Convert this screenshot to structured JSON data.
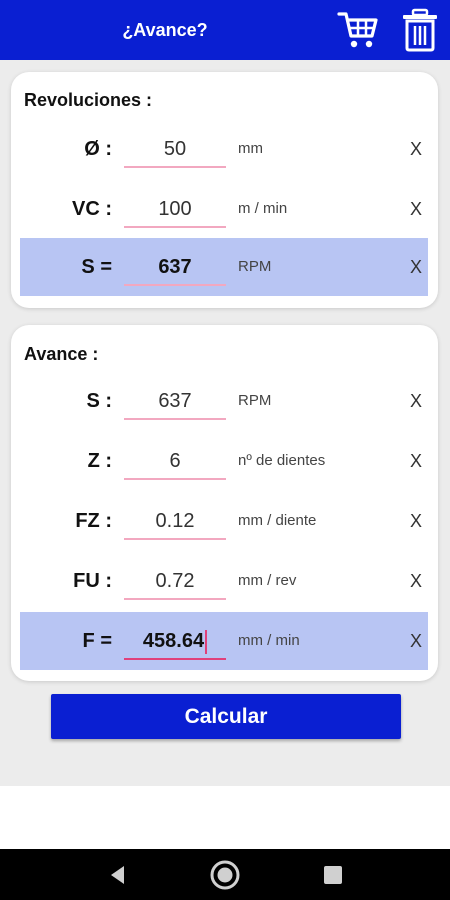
{
  "app": {
    "title": "¿Avance?"
  },
  "toolbar": {
    "cart_icon": "cart-icon",
    "trash_icon": "trash-icon"
  },
  "revoluciones": {
    "title": "Revoluciones :",
    "rows": [
      {
        "label": "Ø :",
        "value": "50",
        "unit": "mm",
        "clear": "X"
      },
      {
        "label": "VC :",
        "value": "100",
        "unit": "m / min",
        "clear": "X"
      },
      {
        "label": "S =",
        "value": "637",
        "unit": "RPM",
        "clear": "X"
      }
    ]
  },
  "avance": {
    "title": "Avance :",
    "rows": [
      {
        "label": "S :",
        "value": "637",
        "unit": "RPM",
        "clear": "X"
      },
      {
        "label": "Z :",
        "value": "6",
        "unit": "nº de dientes",
        "clear": "X"
      },
      {
        "label": "FZ :",
        "value": "0.12",
        "unit": "mm / diente",
        "clear": "X"
      },
      {
        "label": "FU :",
        "value": "0.72",
        "unit": "mm / rev",
        "clear": "X"
      },
      {
        "label": "F =",
        "value": "458.64",
        "unit": "mm / min",
        "clear": "X"
      }
    ]
  },
  "actions": {
    "calculate_label": "Calcular"
  },
  "colors": {
    "primary": "#0a1fd2",
    "highlight": "#b8c5f3",
    "underline": "#f2a8c0"
  }
}
